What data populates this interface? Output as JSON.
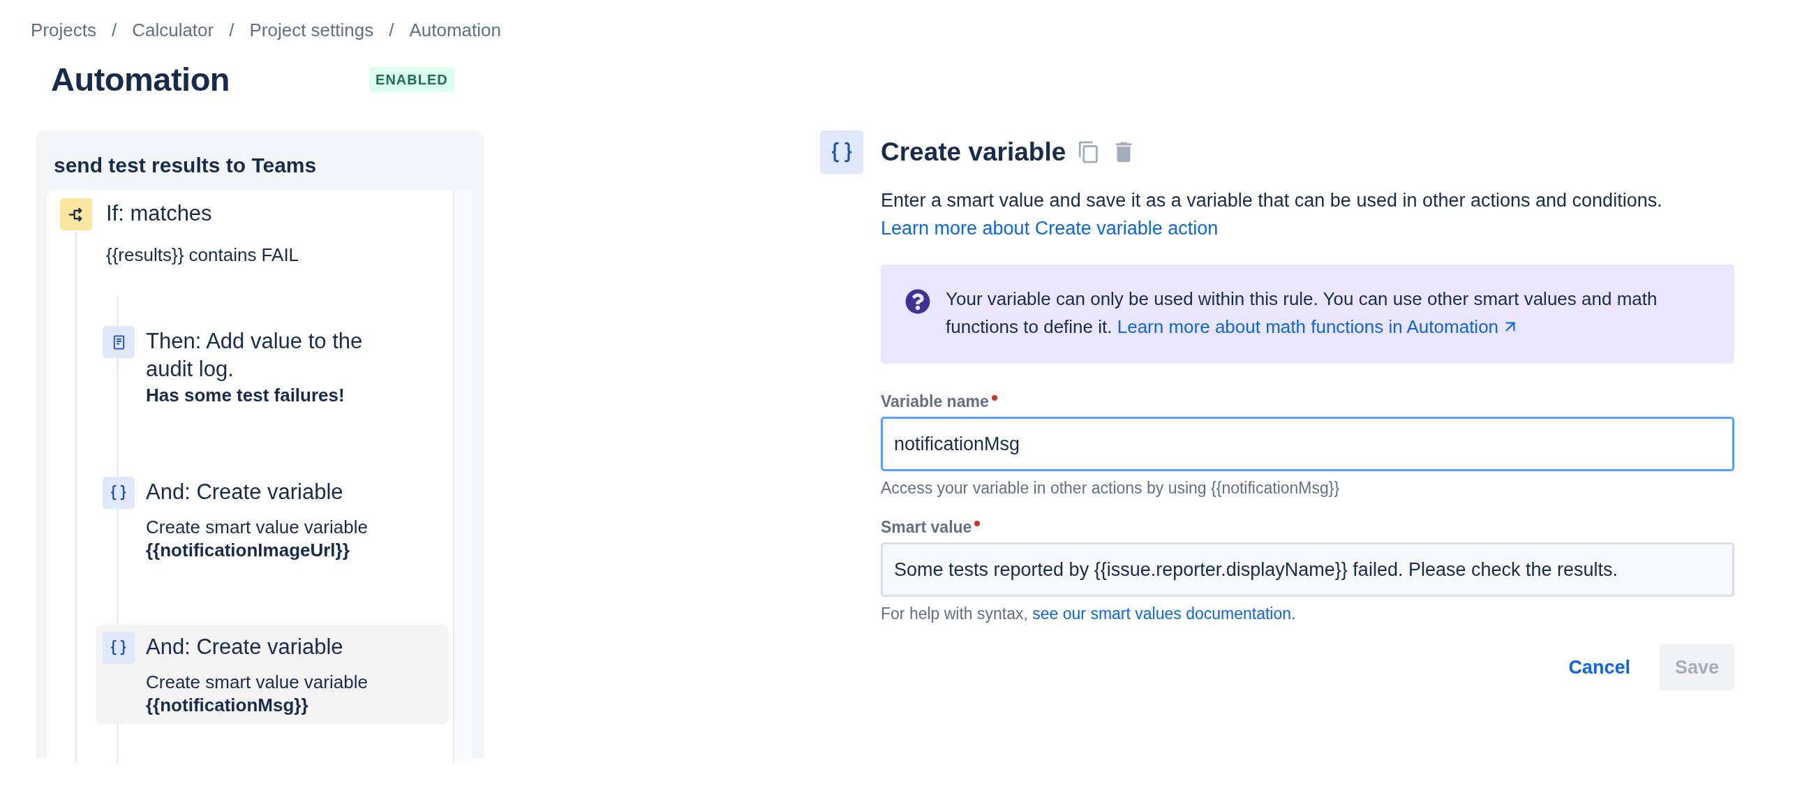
{
  "breadcrumbs": [
    {
      "label": "Projects",
      "separator": "/"
    },
    {
      "label": "Calculator",
      "separator": "/"
    },
    {
      "label": "Project settings",
      "separator": "/"
    },
    {
      "label": "Automation"
    }
  ],
  "page": {
    "title": "Automation",
    "status_badge": "ENABLED"
  },
  "rule": {
    "title": "send test results to Teams",
    "steps": [
      {
        "kind": "condition",
        "title": "If: matches",
        "detail": "{{results}} contains FAIL",
        "selected": false,
        "children": [
          {
            "kind": "log",
            "title": "Then: Add value to the audit log.",
            "value": "Has some test failures!",
            "selected": false
          },
          {
            "kind": "variable",
            "title": "And: Create variable",
            "detail": "Create smart value variable",
            "value": "{{notificationImageUrl}}",
            "selected": false
          },
          {
            "kind": "variable",
            "title": "And: Create variable",
            "detail": "Create smart value variable",
            "value": "{{notificationMsg}}",
            "selected": true
          }
        ]
      }
    ]
  },
  "editor": {
    "kind": "variable",
    "title": "Create variable",
    "description": "Enter a smart value and save it as a variable that can be used in other actions and conditions.",
    "learn_link": "Learn more about Create variable action",
    "info": {
      "text": "Your variable can only be used within this rule. You can use other smart values and math functions to define it.",
      "link": "Learn more about math functions in Automation"
    },
    "fields": [
      {
        "label": "Variable name",
        "required": true,
        "value": "notificationMsg",
        "focused": true,
        "help": "Access your variable in other actions by using {{notificationMsg}}"
      },
      {
        "label": "Smart value",
        "required": true,
        "value": "Some tests reported by {{issue.reporter.displayName}} failed. Please check the results.",
        "focused": false,
        "help": "For help with syntax,",
        "help_link": "see our smart values documentation."
      }
    ],
    "buttons": [
      {
        "label": "Cancel",
        "kind": "link",
        "disabled": false
      },
      {
        "label": "Save",
        "kind": "primary",
        "disabled": true
      }
    ]
  }
}
